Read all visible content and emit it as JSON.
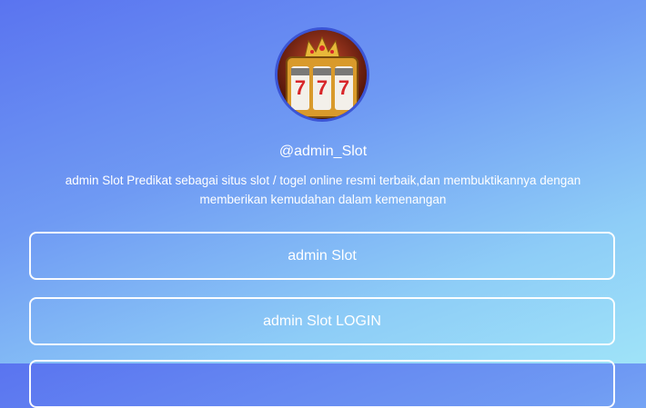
{
  "profile": {
    "avatar_icon": "slot-machine-icon",
    "handle": "@admin_Slot",
    "bio": "admin Slot Predikat sebagai situs slot / togel online resmi terbaik,dan membuktikannya dengan memberikan kemudahan dalam kemenangan"
  },
  "links": [
    {
      "label": "admin Slot"
    },
    {
      "label": "admin Slot LOGIN"
    },
    {
      "label": ""
    }
  ],
  "colors": {
    "gradient_top": "#5a74f0",
    "gradient_bottom": "#9fe3f8",
    "button_border": "#ffffff"
  }
}
